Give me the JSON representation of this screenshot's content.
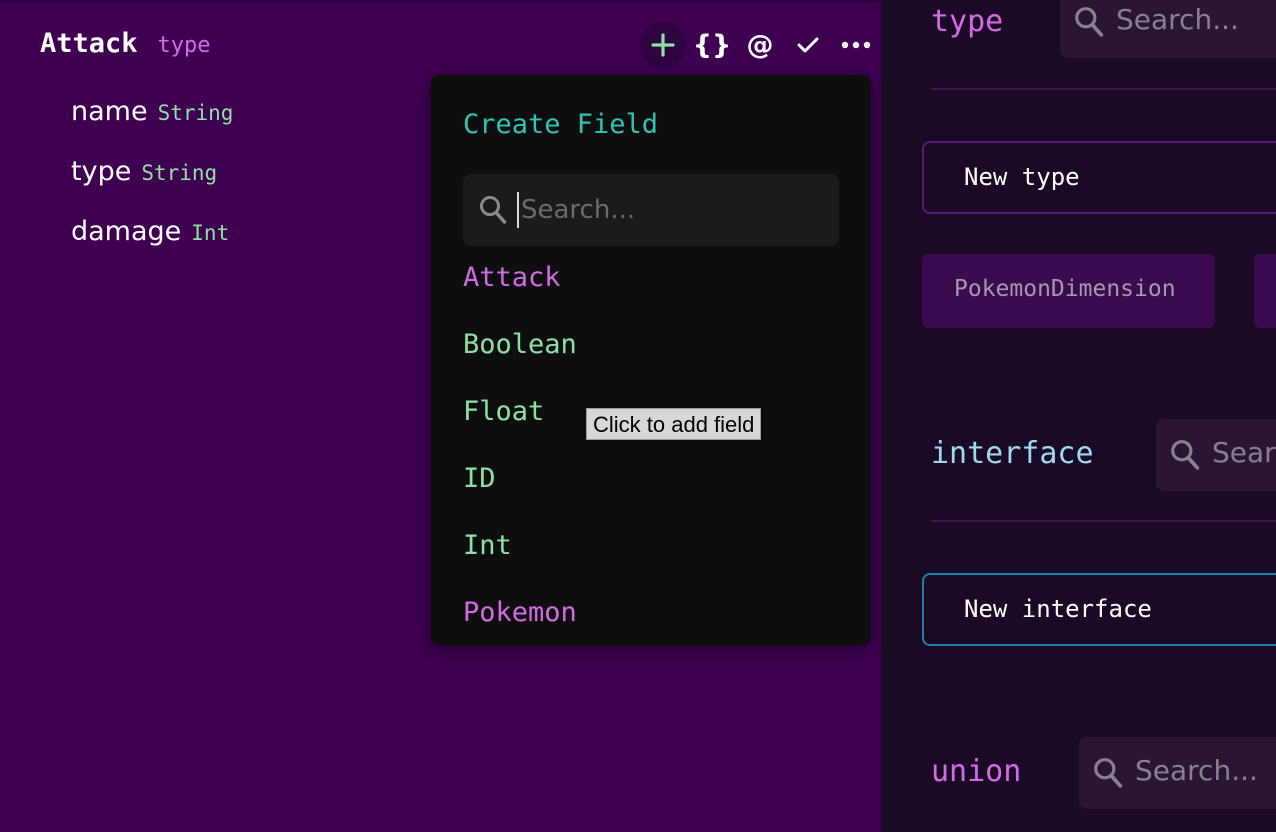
{
  "node": {
    "name": "Attack",
    "kind": "type",
    "fields": [
      {
        "name": "name",
        "type": "String"
      },
      {
        "name": "type",
        "type": "String"
      },
      {
        "name": "damage",
        "type": "Int"
      }
    ]
  },
  "toolbar": {
    "add_icon": "plus-icon",
    "braces_label": "{}",
    "directive_label": "@",
    "check_icon": "check-icon",
    "more_icon": "more-icon"
  },
  "dropdown": {
    "title": "Create Field",
    "search_placeholder": "Search...",
    "items": [
      {
        "label": "Attack",
        "color": "#d46be6"
      },
      {
        "label": "Boolean",
        "color": "#8fe0a3"
      },
      {
        "label": "Float",
        "color": "#8fe0a3"
      },
      {
        "label": "ID",
        "color": "#8fe0a3"
      },
      {
        "label": "Int",
        "color": "#8fe0a3"
      },
      {
        "label": "Pokemon",
        "color": "#d46be6"
      }
    ]
  },
  "tooltip": "Click to add field",
  "sidebar": {
    "type": {
      "label": "type",
      "search_placeholder": "Search...",
      "new_label": "New type",
      "chips": [
        "PokemonDimension"
      ]
    },
    "interface": {
      "label": "interface",
      "search_placeholder": "Search",
      "new_label": "New interface"
    },
    "union": {
      "label": "union",
      "search_placeholder": "Search..."
    }
  },
  "colors": {
    "background": "#3f0052",
    "sidebar_bg": "#1b0a26",
    "type_accent": "#d46be6",
    "scalar_accent": "#8fe0a3",
    "title_accent": "#2ec4b6",
    "interface_accent": "#9fd8f0"
  }
}
